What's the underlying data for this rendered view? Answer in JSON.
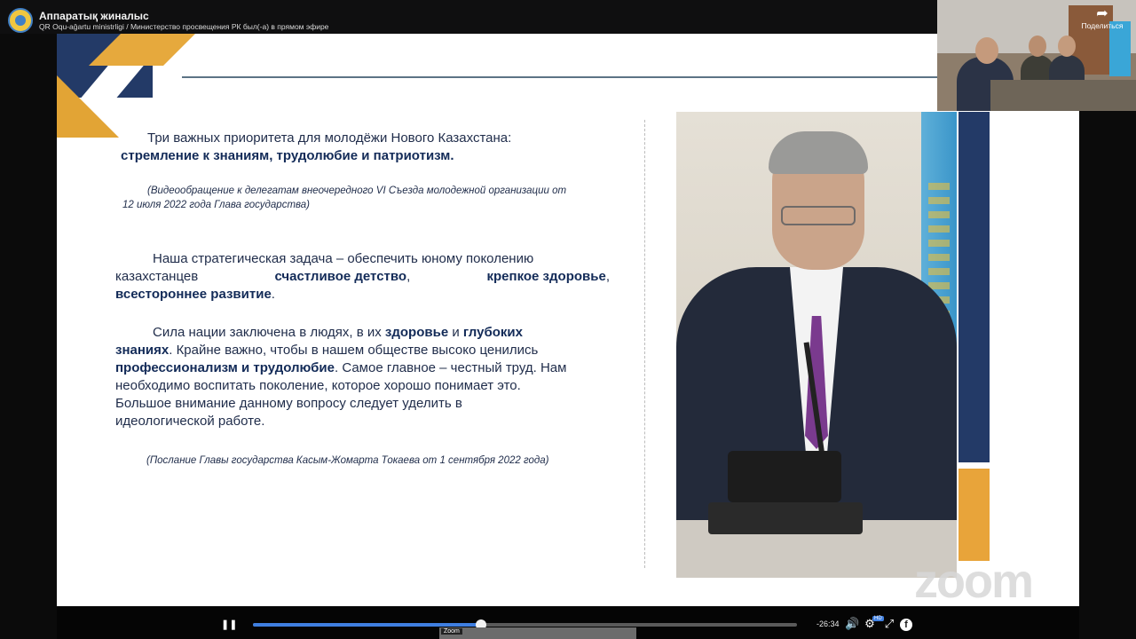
{
  "stream": {
    "channel_title": "Аппаратық жиналыс",
    "channel_subtitle": "QR Oqu-ağartu ministrligi / Министерство просвещения РК был(-а) в прямом эфире"
  },
  "slide": {
    "quote1_lines": [
      "Три важных приоритета для молодёжи Нового Казахстана:",
      "стремление к знаниям, трудолюбие и патриотизм."
    ],
    "quote1_citation": [
      "(Видеообращение к делегатам внеочередного VI Съезда молодежной организации от",
      "12 июля 2022 года Глава государства)"
    ],
    "para2_lines": [
      "Наша стратегическая задача – обеспечить юному поколению",
      "казахстанцев",
      "счастливое детство",
      "крепкое здоровье",
      "всестороннее развитие"
    ],
    "para3_lines": [
      "Сила нации заключена в людях, в их",
      "здоровье",
      "и",
      "глубоких",
      "знаниях",
      ". Крайне важно, чтобы в нашем обществе высоко ценились",
      "профессионализм и трудолюбие",
      ". Самое главное – честный труд. Нам",
      "необходимо воспитать поколение, которое хорошо понимает это.",
      "Большое внимание данному вопросу следует уделить в",
      "идеологической работе."
    ],
    "quote2_citation": "(Послание Главы государства Касым-Жомарта Токаева от 1 сентября 2022 года)"
  },
  "video_tile": {
    "share_label": "Поделиться",
    "share_icon": "share-arrow-icon"
  },
  "player": {
    "progress": 0.42,
    "time_remaining": "-26:34",
    "preview_label": "Zoom",
    "icons": [
      "pause-icon",
      "volume-icon",
      "settings-gear-icon",
      "fullscreen-icon",
      "facebook-icon"
    ],
    "hd_badge": "HD",
    "accent_color": "#3f7fe0"
  },
  "watermark": "zoom"
}
